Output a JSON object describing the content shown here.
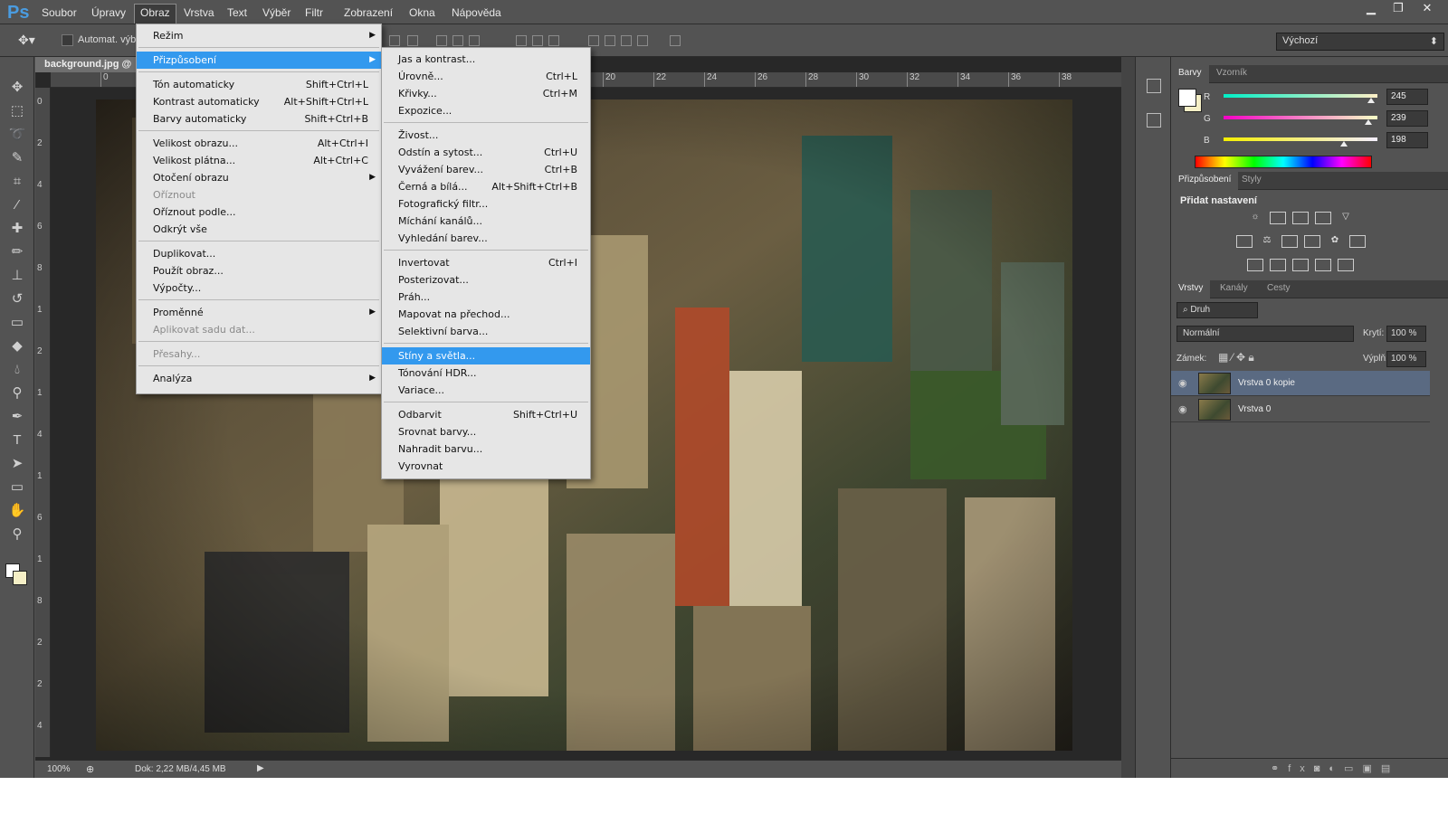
{
  "app": {
    "logo": "Ps",
    "window_controls": [
      "minimize-icon",
      "restore-icon",
      "close-icon"
    ]
  },
  "menubar": {
    "items": [
      "Soubor",
      "Úpravy",
      "Obraz",
      "Vrstva",
      "Text",
      "Výběr",
      "Filtr",
      "Zobrazení",
      "Okna",
      "Nápověda"
    ],
    "active": "Obraz"
  },
  "options": {
    "auto_select_label": "Automat. výbě",
    "workspace": "Výchozí"
  },
  "document": {
    "tab": "background.jpg @",
    "zoom": "100%",
    "doc_info": "Dok: 2,22 MB/4,45 MB",
    "ruler_top": [
      "0",
      "20",
      "22",
      "24",
      "26",
      "28",
      "30",
      "32",
      "34",
      "36",
      "38"
    ],
    "ruler_left": [
      "0",
      "2",
      "4",
      "6",
      "8",
      "1",
      "2",
      "1",
      "4",
      "1",
      "6",
      "1",
      "8",
      "2",
      "2",
      "4"
    ]
  },
  "tools": [
    "move-tool-icon",
    "marquee-tool-icon",
    "lasso-tool-icon",
    "quick-select-tool-icon",
    "crop-tool-icon",
    "eyedropper-tool-icon",
    "healing-brush-icon",
    "brush-tool-icon",
    "clone-stamp-icon",
    "history-brush-icon",
    "eraser-tool-icon",
    "paint-bucket-icon",
    "blur-tool-icon",
    "dodge-tool-icon",
    "pen-tool-icon",
    "type-tool-icon",
    "path-select-icon",
    "shape-tool-icon",
    "hand-tool-icon",
    "zoom-tool-icon"
  ],
  "obraz_menu": [
    {
      "label": "Režim",
      "shortcut": "",
      "submenu": true
    },
    {
      "sep": true
    },
    {
      "label": "Přizpůsobení",
      "shortcut": "",
      "submenu": true,
      "highlight": true
    },
    {
      "sep": true
    },
    {
      "label": "Tón automaticky",
      "shortcut": "Shift+Ctrl+L"
    },
    {
      "label": "Kontrast automaticky",
      "shortcut": "Alt+Shift+Ctrl+L"
    },
    {
      "label": "Barvy automaticky",
      "shortcut": "Shift+Ctrl+B"
    },
    {
      "sep": true
    },
    {
      "label": "Velikost obrazu...",
      "shortcut": "Alt+Ctrl+I"
    },
    {
      "label": "Velikost plátna...",
      "shortcut": "Alt+Ctrl+C"
    },
    {
      "label": "Otočení obrazu",
      "shortcut": "",
      "submenu": true
    },
    {
      "label": "Oříznout",
      "shortcut": "",
      "disabled": true
    },
    {
      "label": "Oříznout podle...",
      "shortcut": ""
    },
    {
      "label": "Odkrýt vše",
      "shortcut": ""
    },
    {
      "sep": true
    },
    {
      "label": "Duplikovat...",
      "shortcut": ""
    },
    {
      "label": "Použít obraz...",
      "shortcut": ""
    },
    {
      "label": "Výpočty...",
      "shortcut": ""
    },
    {
      "sep": true
    },
    {
      "label": "Proměnné",
      "shortcut": "",
      "submenu": true
    },
    {
      "label": "Aplikovat sadu dat...",
      "shortcut": "",
      "disabled": true
    },
    {
      "sep": true
    },
    {
      "label": "Přesahy...",
      "shortcut": "",
      "disabled": true
    },
    {
      "sep": true
    },
    {
      "label": "Analýza",
      "shortcut": "",
      "submenu": true
    }
  ],
  "adjust_menu": [
    {
      "label": "Jas a kontrast...",
      "shortcut": ""
    },
    {
      "label": "Úrovně...",
      "shortcut": "Ctrl+L"
    },
    {
      "label": "Křivky...",
      "shortcut": "Ctrl+M"
    },
    {
      "label": "Expozice...",
      "shortcut": ""
    },
    {
      "sep": true
    },
    {
      "label": "Živost...",
      "shortcut": ""
    },
    {
      "label": "Odstín a sytost...",
      "shortcut": "Ctrl+U"
    },
    {
      "label": "Vyvážení barev...",
      "shortcut": "Ctrl+B"
    },
    {
      "label": "Černá a bílá...",
      "shortcut": "Alt+Shift+Ctrl+B"
    },
    {
      "label": "Fotografický filtr...",
      "shortcut": ""
    },
    {
      "label": "Míchání kanálů...",
      "shortcut": ""
    },
    {
      "label": "Vyhledání barev...",
      "shortcut": ""
    },
    {
      "sep": true
    },
    {
      "label": "Invertovat",
      "shortcut": "Ctrl+I"
    },
    {
      "label": "Posterizovat...",
      "shortcut": ""
    },
    {
      "label": "Práh...",
      "shortcut": ""
    },
    {
      "label": "Mapovat na přechod...",
      "shortcut": ""
    },
    {
      "label": "Selektivní barva...",
      "shortcut": ""
    },
    {
      "sep": true
    },
    {
      "label": "Stíny a světla...",
      "shortcut": "",
      "highlight": true
    },
    {
      "label": "Tónování HDR...",
      "shortcut": ""
    },
    {
      "label": "Variace...",
      "shortcut": ""
    },
    {
      "sep": true
    },
    {
      "label": "Odbarvit",
      "shortcut": "Shift+Ctrl+U"
    },
    {
      "label": "Srovnat barvy...",
      "shortcut": ""
    },
    {
      "label": "Nahradit barvu...",
      "shortcut": ""
    },
    {
      "label": "Vyrovnat",
      "shortcut": ""
    }
  ],
  "color_panel": {
    "tabs": [
      "Barvy",
      "Vzorník"
    ],
    "r_label": "R",
    "g_label": "G",
    "b_label": "B",
    "r": "245",
    "g": "239",
    "b": "198",
    "r_level": 0.96,
    "g_level": 0.94,
    "b_level": 0.78,
    "foreground": "#f5efc6",
    "background": "#ffffff"
  },
  "adjust_panel": {
    "tabs": [
      "Přizpůsobení",
      "Styly"
    ],
    "title": "Přidat nastavení"
  },
  "layers_panel": {
    "tabs": [
      "Vrstvy",
      "Kanály",
      "Cesty"
    ],
    "kind": "Druh",
    "blend_mode": "Normální",
    "opacity_label": "Krytí:",
    "opacity": "100 %",
    "lock_label": "Zámek:",
    "fill_label": "Výplň:",
    "fill": "100 %",
    "layers": [
      {
        "name": "Vrstva 0 kopie",
        "selected": true
      },
      {
        "name": "Vrstva 0",
        "selected": false
      }
    ]
  },
  "colors": {
    "ui_bg": "#535353",
    "highlight": "#3399ee",
    "accent_blue": "#4a9ce0"
  }
}
